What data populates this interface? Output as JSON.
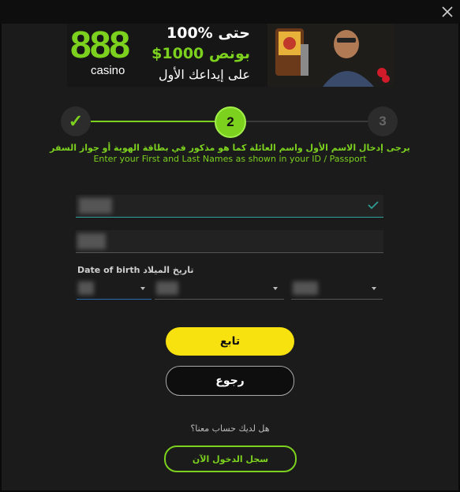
{
  "banner": {
    "logo_main": "888",
    "logo_sub": "casino",
    "promo_line1": "100% حتى",
    "promo_line2": "$1000 بونص",
    "promo_line3": "على إيداعك الأول"
  },
  "stepper": {
    "step1": "✓",
    "step2": "2",
    "step3": "3",
    "current_step": 2,
    "total_steps": 3
  },
  "instructions": {
    "arabic": "يرجى إدخال الاسم الأول واسم العائلة كما هو مذكور في بطاقة الهوية أو جواز السفر",
    "english": "Enter your First and Last Names as shown in your ID / Passport"
  },
  "dob": {
    "label": "Date of birth  تاريخ الميلاد"
  },
  "buttons": {
    "continue": "تابع",
    "back": "رجوع",
    "login": "سجل الدخول الآن"
  },
  "footer": {
    "have_account": "هل لديك حساب معنا؟"
  },
  "colors": {
    "accent_green": "#7cd11f",
    "button_yellow": "#f7e10e",
    "field_focus": "#2fa39b"
  },
  "icons": {
    "close": "close-icon",
    "check": "check-icon",
    "caret": "chevron-down-icon"
  }
}
